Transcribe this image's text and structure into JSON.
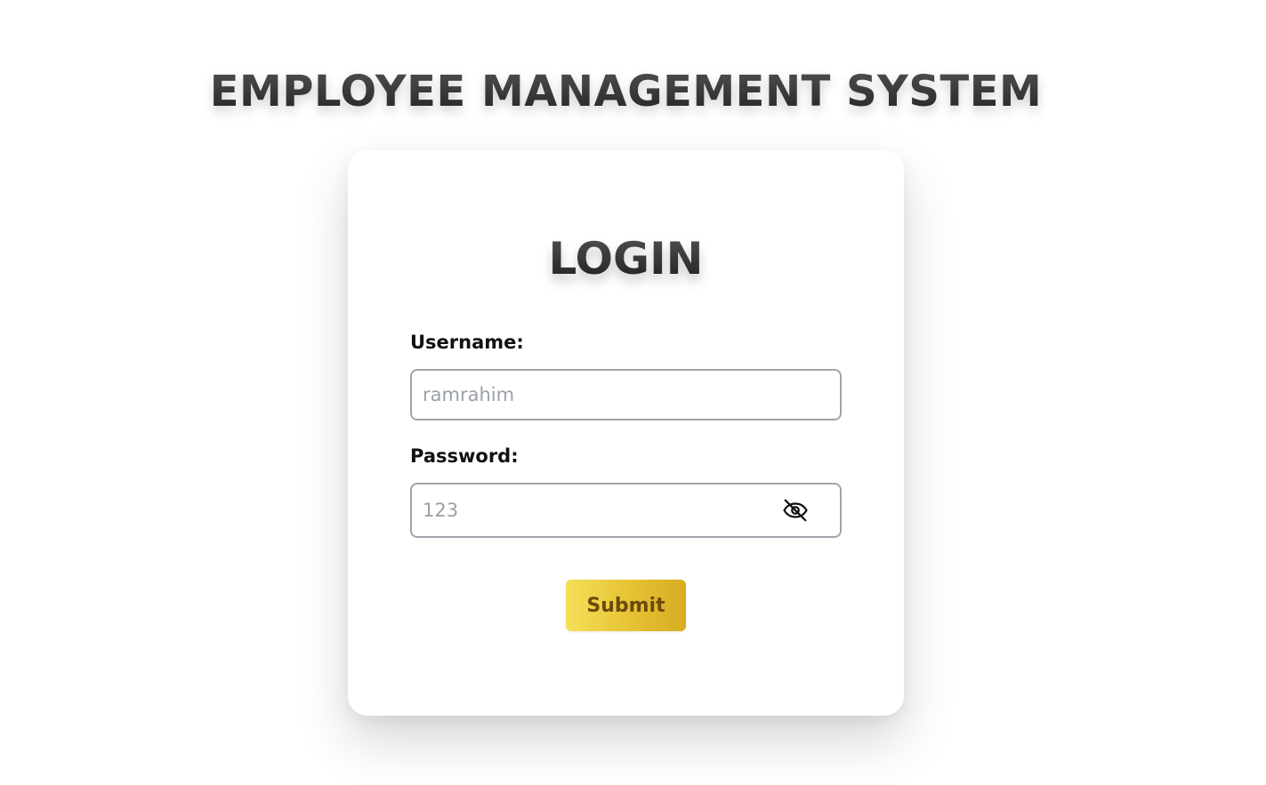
{
  "app": {
    "title": "EMPLOYEE MANAGEMENT SYSTEM"
  },
  "login": {
    "heading": "LOGIN",
    "username": {
      "label": "Username:",
      "placeholder": "ramrahim",
      "value": ""
    },
    "password": {
      "label": "Password:",
      "placeholder": "123",
      "value": "",
      "visibility_icon": "eye-slash-icon"
    },
    "submit_label": "Submit"
  },
  "colors": {
    "button_gradient_start": "#f4e05a",
    "button_gradient_end": "#d7ac21",
    "button_text": "#6b4a0c",
    "input_border": "#a3a3ad",
    "placeholder_text": "#9aa0aa",
    "heading_dark": "#1f1f1f"
  }
}
